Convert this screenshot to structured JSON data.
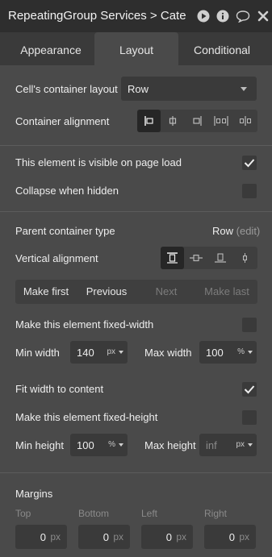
{
  "window": {
    "title": "RepeatingGroup Services > Cate"
  },
  "tabs": [
    "Appearance",
    "Layout",
    "Conditional"
  ],
  "layout": {
    "cell_layout_label": "Cell's container layout",
    "cell_layout_value": "Row",
    "container_alignment_label": "Container alignment",
    "visible_label": "This element is visible on page load",
    "visible_checked": true,
    "collapse_label": "Collapse when hidden",
    "collapse_checked": false,
    "parent_type_label": "Parent container type",
    "parent_type_value": "Row",
    "parent_type_edit": "(edit)",
    "vertical_alignment_label": "Vertical alignment",
    "nav": [
      "Make first",
      "Previous",
      "Next",
      "Make last"
    ],
    "fixed_width_label": "Make this element fixed-width",
    "fixed_width_checked": false,
    "min_width_label": "Min width",
    "min_width_value": "140",
    "min_width_unit": "px",
    "max_width_label": "Max width",
    "max_width_value": "100",
    "max_width_unit": "%",
    "fit_width_label": "Fit width to content",
    "fit_width_checked": true,
    "fixed_height_label": "Make this element fixed-height",
    "fixed_height_checked": false,
    "min_height_label": "Min height",
    "min_height_value": "100",
    "min_height_unit": "%",
    "max_height_label": "Max height",
    "max_height_placeholder": "inf",
    "max_height_unit": "px"
  },
  "margins": {
    "title": "Margins",
    "labels": [
      "Top",
      "Bottom",
      "Left",
      "Right"
    ],
    "values": [
      "0",
      "0",
      "0",
      "0"
    ],
    "unit": "px"
  },
  "colors": {
    "panel": "#4a4a4a",
    "titlebar": "#2e2e2e",
    "input": "#3a3a3a",
    "active_segment": "#262626"
  }
}
